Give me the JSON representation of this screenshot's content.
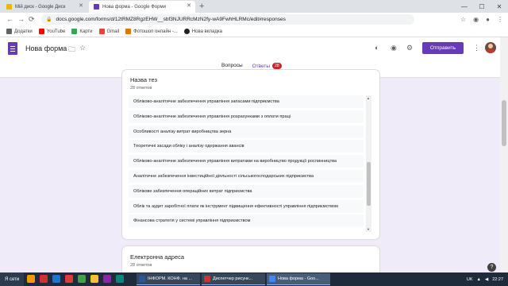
{
  "browser": {
    "tabs": [
      {
        "title": "Мій диск - Google Диск",
        "active": false,
        "favicon_color": "#f4b400"
      },
      {
        "title": "Нова форма - Google Форми",
        "active": true,
        "favicon_color": "#673ab7"
      }
    ],
    "new_tab": "+",
    "window_controls": {
      "minimize": "—",
      "maximize": "☐",
      "close": "✕"
    },
    "url": "docs.google.com/forms/d/12tRMZ8RgzEHW__sbf3NJURRcMzN2fy-wA9FwhHLRMc/edit#responses",
    "nav": {
      "back": "←",
      "forward": "→",
      "reload": "⟳"
    }
  },
  "bookmarks": [
    {
      "label": "Додатки",
      "icon": "apps-icon",
      "color": "#5f6368"
    },
    {
      "label": "YouTube",
      "icon": "youtube-icon",
      "color": "#ff0000"
    },
    {
      "label": "Карти",
      "icon": "maps-icon",
      "color": "#34a853"
    },
    {
      "label": "Gmail",
      "icon": "gmail-icon",
      "color": "#ea4335"
    },
    {
      "label": "Фотошоп онлайн -...",
      "icon": "photoshop-icon",
      "color": "#e37400"
    },
    {
      "label": "Нова вкладка",
      "icon": "globe-icon",
      "color": "#202124"
    }
  ],
  "form": {
    "title": "Нова форма",
    "send_label": "Отправить",
    "tabs": {
      "questions": "Вопросы",
      "responses": "Ответы",
      "responses_count": "28"
    },
    "accent": "#673ab7"
  },
  "question1": {
    "title": "Назва тез",
    "count": "28 ответов",
    "responses": [
      "Обліково-аналітичне забезпечення управління запасами підприємства",
      "Обліково-аналітичне забезпечення управління розрахунками з оплати праці",
      "Особливості аналізу витрат виробництва зерна",
      "Теоретичні засади обліку і аналізу одержання авансів",
      "Обліково-аналітичне забезпечення управління витратами на виробництво продукції рослинництва",
      "Аналітичне забезпечення інвестиційної діяльності сільськогосподарських підприємства",
      "Облікове забезпечення операційних витрат підприємства",
      "Облік та аудит заробітної плати як інструмент підвищення ефективності управління підприємством",
      "Фінансова стратегія у системі управління підприємством"
    ]
  },
  "question2": {
    "title": "Електронна адреса",
    "count": "28 ответов"
  },
  "help": "?",
  "taskbar": {
    "start": "Я сети",
    "tasks": [
      {
        "label": "ІНФОРМ. КОНФ. на ...",
        "color": "#2b579a"
      },
      {
        "label": "Диспетчер рисунк...",
        "color": "#c0392b"
      },
      {
        "label": "Нова форма - Goo...",
        "color": "#4285f4"
      }
    ],
    "lang": "UK",
    "clock": "22:27"
  }
}
